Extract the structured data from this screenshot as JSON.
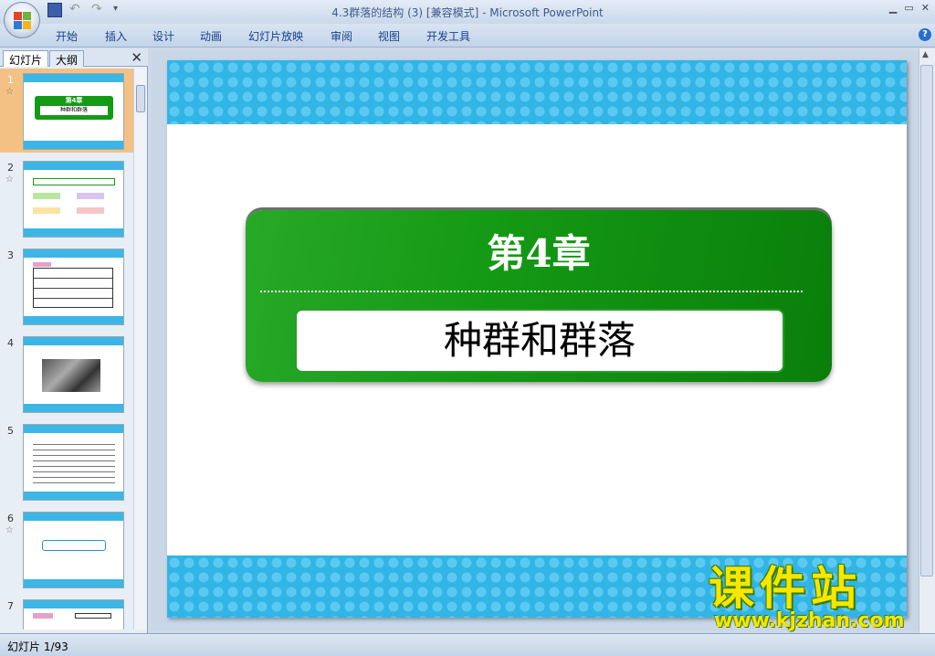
{
  "window": {
    "title": "4.3群落的结构 (3) [兼容模式] - Microsoft PowerPoint"
  },
  "ribbon": {
    "tabs": [
      "开始",
      "插入",
      "设计",
      "动画",
      "幻灯片放映",
      "审阅",
      "视图",
      "开发工具"
    ]
  },
  "panel": {
    "tab_slides": "幻灯片",
    "tab_outline": "大纲",
    "close": "✕"
  },
  "thumbnails": [
    {
      "num": "1",
      "selected": true,
      "has_anim": true,
      "heading": "第4章",
      "sub": "种群和群落"
    },
    {
      "num": "2",
      "selected": false,
      "has_anim": true
    },
    {
      "num": "3",
      "selected": false,
      "has_anim": false
    },
    {
      "num": "4",
      "selected": false,
      "has_anim": false
    },
    {
      "num": "5",
      "selected": false,
      "has_anim": false
    },
    {
      "num": "6",
      "selected": false,
      "has_anim": true
    },
    {
      "num": "7",
      "selected": false,
      "has_anim": false
    }
  ],
  "slide": {
    "chapter": "第4章",
    "subtitle": "种群和群落"
  },
  "status": {
    "slide_count": "幻灯片 1/93"
  },
  "watermark": {
    "logo": "课件站",
    "url": "www.kjzhan.com"
  },
  "colors": {
    "band": "#31b4e6",
    "green": "#159a15",
    "selected_thumb": "#f4c185"
  }
}
